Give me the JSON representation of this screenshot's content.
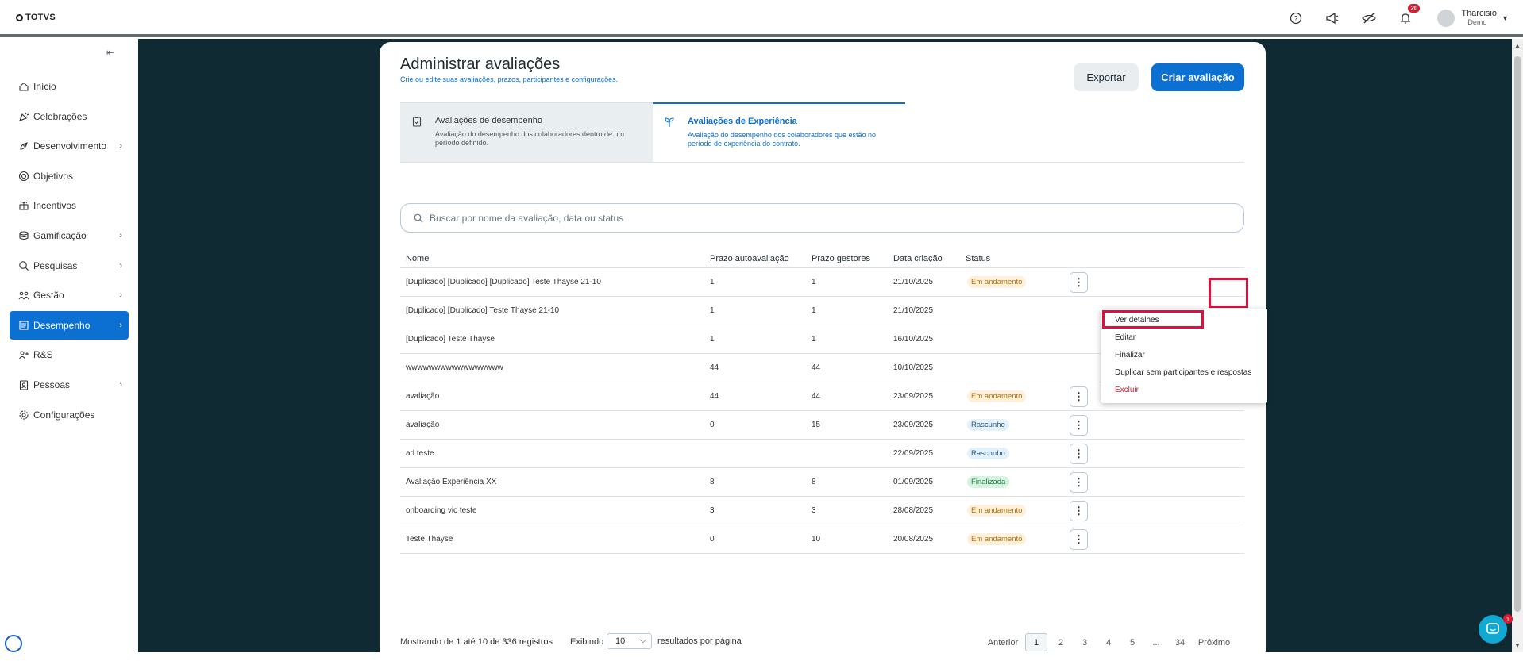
{
  "topbar": {
    "logo": "TOTVS",
    "notification_count": "20",
    "user_name": "Tharcisio",
    "user_sub": "Demo"
  },
  "sidebar": {
    "items": [
      {
        "label": "Início",
        "icon": "home-icon",
        "has_arrow": false
      },
      {
        "label": "Celebrações",
        "icon": "party-icon",
        "has_arrow": false
      },
      {
        "label": "Desenvolvimento",
        "icon": "rocket-icon",
        "has_arrow": true
      },
      {
        "label": "Objetivos",
        "icon": "target-icon",
        "has_arrow": false
      },
      {
        "label": "Incentivos",
        "icon": "gift-icon",
        "has_arrow": false
      },
      {
        "label": "Gamificação",
        "icon": "coins-icon",
        "has_arrow": true
      },
      {
        "label": "Pesquisas",
        "icon": "search-doc-icon",
        "has_arrow": true
      },
      {
        "label": "Gestão",
        "icon": "team-icon",
        "has_arrow": true
      },
      {
        "label": "Desempenho",
        "icon": "chart-icon",
        "has_arrow": true,
        "active": true
      },
      {
        "label": "R&S",
        "icon": "recruit-icon",
        "has_arrow": false
      },
      {
        "label": "Pessoas",
        "icon": "badge-icon",
        "has_arrow": true
      },
      {
        "label": "Configurações",
        "icon": "gear-icon",
        "has_arrow": false
      }
    ]
  },
  "header": {
    "title": "Administrar avaliações",
    "subtitle": "Crie ou edite suas avaliações, prazos, participantes e configurações.",
    "export_label": "Exportar",
    "create_label": "Criar avaliação"
  },
  "tabs": [
    {
      "title": "Avaliações de desempenho",
      "desc": "Avaliação do desempenho dos colaboradores dentro de um período definido."
    },
    {
      "title": "Avaliações de Experiência",
      "desc": "Avaliação do desempenho dos colaboradores que estão no período de experiência do contrato."
    }
  ],
  "search": {
    "placeholder": "Buscar por nome da avaliação, data ou status"
  },
  "table": {
    "headers": {
      "nome": "Nome",
      "prazo_auto": "Prazo autoavaliação",
      "prazo_gest": "Prazo gestores",
      "data": "Data criação",
      "status": "Status"
    },
    "rows": [
      {
        "nome": "[Duplicado] [Duplicado] [Duplicado] Teste Thayse 21-10",
        "auto": "1",
        "gest": "1",
        "data": "21/10/2025",
        "status": "Em andamento",
        "kind": "and"
      },
      {
        "nome": "[Duplicado] [Duplicado] Teste Thayse 21-10",
        "auto": "1",
        "gest": "1",
        "data": "21/10/2025",
        "status": "",
        "kind": ""
      },
      {
        "nome": "[Duplicado] Teste Thayse",
        "auto": "1",
        "gest": "1",
        "data": "16/10/2025",
        "status": "",
        "kind": ""
      },
      {
        "nome": "wwwwwwwwwwwwwwwww",
        "auto": "44",
        "gest": "44",
        "data": "10/10/2025",
        "status": "",
        "kind": ""
      },
      {
        "nome": "avaliação",
        "auto": "44",
        "gest": "44",
        "data": "23/09/2025",
        "status": "Em andamento",
        "kind": "and"
      },
      {
        "nome": "avaliação",
        "auto": "0",
        "gest": "15",
        "data": "23/09/2025",
        "status": "Rascunho",
        "kind": "ras"
      },
      {
        "nome": "ad teste",
        "auto": "",
        "gest": "",
        "data": "22/09/2025",
        "status": "Rascunho",
        "kind": "ras"
      },
      {
        "nome": "Avaliação Experiência XX",
        "auto": "8",
        "gest": "8",
        "data": "01/09/2025",
        "status": "Finalizada",
        "kind": "fin"
      },
      {
        "nome": "onboarding vic teste",
        "auto": "3",
        "gest": "3",
        "data": "28/08/2025",
        "status": "Em andamento",
        "kind": "and"
      },
      {
        "nome": "Teste Thayse",
        "auto": "0",
        "gest": "10",
        "data": "20/08/2025",
        "status": "Em andamento",
        "kind": "and"
      }
    ]
  },
  "menu": {
    "items": [
      "Ver detalhes",
      "Editar",
      "Finalizar",
      "Duplicar sem participantes e respostas",
      "Excluir"
    ]
  },
  "footer": {
    "showing": "Mostrando de 1 até 10 de 336 registros",
    "exibindo": "Exibindo",
    "page_size": "10",
    "per_page": "resultados por página",
    "prev": "Anterior",
    "pages": [
      "1",
      "2",
      "3",
      "4",
      "5",
      "...",
      "34"
    ],
    "next": "Próximo"
  },
  "chat": {
    "badge": "1"
  }
}
